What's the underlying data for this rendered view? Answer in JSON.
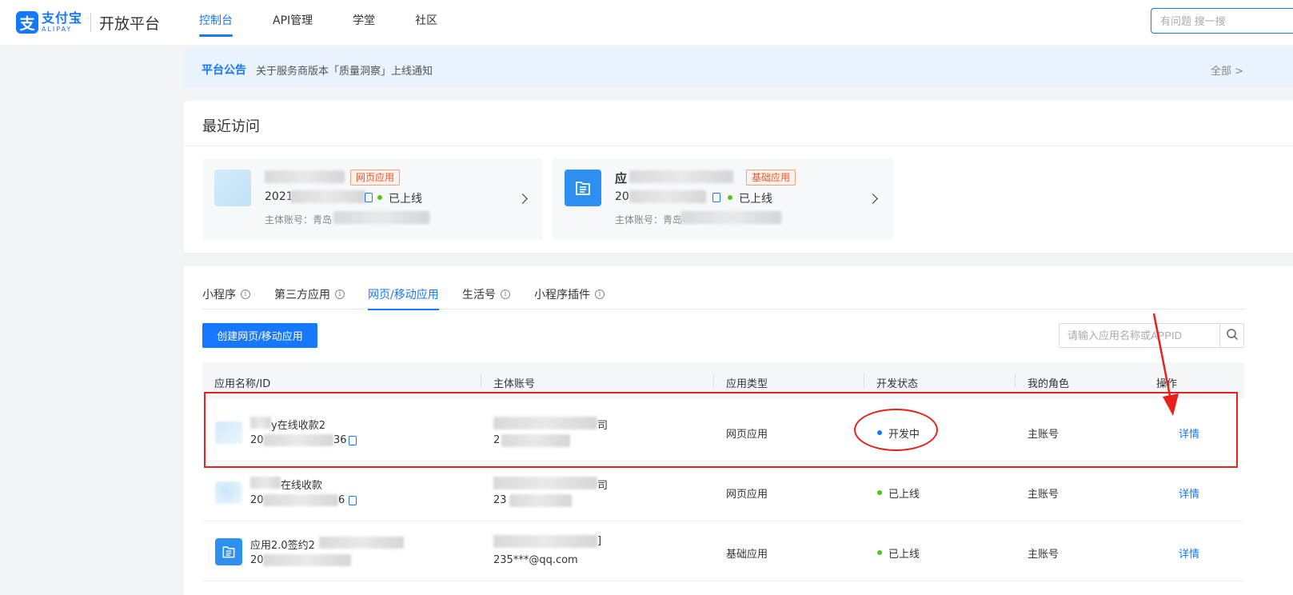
{
  "header": {
    "logo": {
      "mark": "支",
      "name_cn": "支付宝",
      "name_en": "ALIPAY",
      "platform": "开放平台"
    },
    "nav": [
      {
        "label": "控制台",
        "active": true
      },
      {
        "label": "API管理",
        "active": false
      },
      {
        "label": "学堂",
        "active": false
      },
      {
        "label": "社区",
        "active": false
      }
    ],
    "search_placeholder": "有问题 搜一搜"
  },
  "notice": {
    "tag": "平台公告",
    "text": "关于服务商版本「质量洞察」上线通知",
    "all": "全部 >"
  },
  "recent": {
    "title": "最近访问",
    "cards": [
      {
        "name": "",
        "tag": "网页应用",
        "id_prefix": "2021",
        "status": "已上线",
        "owner_label": "主体账号：青岛"
      },
      {
        "name": "应",
        "tag": "基础应用",
        "id_prefix": "20",
        "status": "已上线",
        "owner_label": "主体账号：青岛"
      }
    ]
  },
  "apps": {
    "tabs": [
      {
        "label": "小程序",
        "info": true,
        "active": false
      },
      {
        "label": "第三方应用",
        "info": true,
        "active": false
      },
      {
        "label": "网页/移动应用",
        "info": false,
        "active": true
      },
      {
        "label": "生活号",
        "info": true,
        "active": false
      },
      {
        "label": "小程序插件",
        "info": true,
        "active": false
      }
    ],
    "info_glyph": "i",
    "create_button": "创建网页/移动应用",
    "search_placeholder": "请输入应用名称或APPID",
    "columns": [
      "应用名称/ID",
      "主体账号",
      "应用类型",
      "开发状态",
      "我的角色",
      "操作"
    ],
    "rows": [
      {
        "name": "y在线收款2",
        "id_prefix": "20",
        "id_suffix": "36",
        "owner_tail": "司",
        "owner_line2": "2",
        "type": "网页应用",
        "status": "开发中",
        "status_color": "#1677ff",
        "role": "主账号",
        "action": "详情"
      },
      {
        "name": "在线收款",
        "id_prefix": "20",
        "id_suffix": "6",
        "owner_tail": "司",
        "owner_line2": "23",
        "type": "网页应用",
        "status": "已上线",
        "status_color": "#52c41a",
        "role": "主账号",
        "action": "详情"
      },
      {
        "name": "应用2.0签约2",
        "id_prefix": "20",
        "id_suffix": "",
        "owner_tail": "]",
        "owner_line2": "235***@qq.com",
        "type": "基础应用",
        "status": "已上线",
        "status_color": "#52c41a",
        "role": "主账号",
        "action": "详情"
      }
    ]
  },
  "colors": {
    "primary": "#1677ff",
    "success": "#52c41a",
    "annotation": "#e8211c"
  }
}
